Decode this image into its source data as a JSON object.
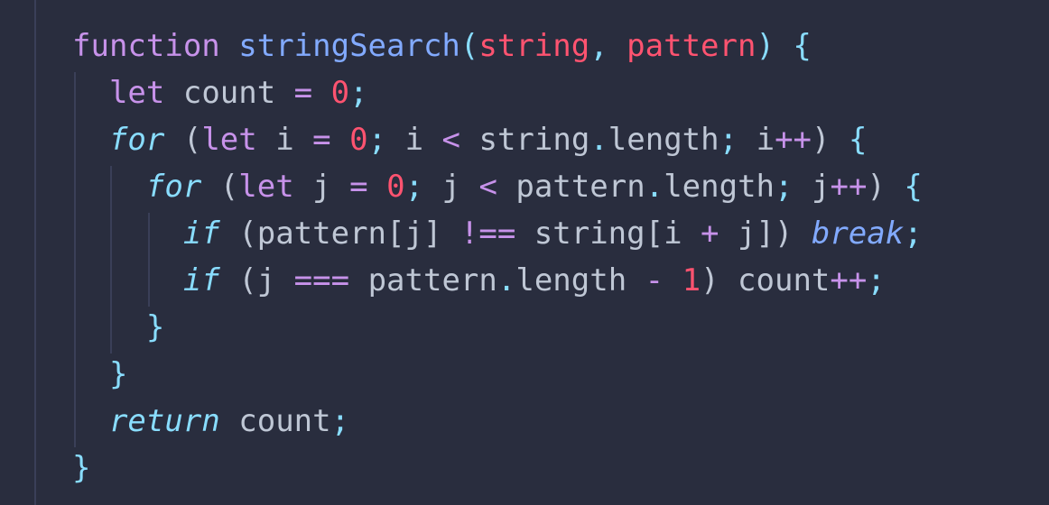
{
  "editor": {
    "theme_colors": {
      "background": "#292d3e",
      "keyword": "#c792ea",
      "function": "#82aaff",
      "parameter": "#ff5370",
      "number": "#ff5370",
      "punctuation": "#89ddff",
      "text": "#bfc7d5"
    },
    "lines": [
      {
        "tokens": [
          {
            "t": "function",
            "c": "kw"
          },
          {
            "t": " ",
            "c": "plain"
          },
          {
            "t": "stringSearch",
            "c": "fn"
          },
          {
            "t": "(",
            "c": "punc"
          },
          {
            "t": "string",
            "c": "param"
          },
          {
            "t": ", ",
            "c": "punc"
          },
          {
            "t": "pattern",
            "c": "param"
          },
          {
            "t": ")",
            "c": "punc"
          },
          {
            "t": " ",
            "c": "plain"
          },
          {
            "t": "{",
            "c": "punc"
          }
        ]
      },
      {
        "tokens": [
          {
            "t": "  ",
            "c": "plain"
          },
          {
            "t": "let",
            "c": "kw"
          },
          {
            "t": " count ",
            "c": "plain"
          },
          {
            "t": "=",
            "c": "op"
          },
          {
            "t": " ",
            "c": "plain"
          },
          {
            "t": "0",
            "c": "num-red"
          },
          {
            "t": ";",
            "c": "punc"
          }
        ]
      },
      {
        "tokens": [
          {
            "t": "  ",
            "c": "plain"
          },
          {
            "t": "for",
            "c": "ctl"
          },
          {
            "t": " (",
            "c": "plain"
          },
          {
            "t": "let",
            "c": "kw"
          },
          {
            "t": " i ",
            "c": "plain"
          },
          {
            "t": "=",
            "c": "op"
          },
          {
            "t": " ",
            "c": "plain"
          },
          {
            "t": "0",
            "c": "num-red"
          },
          {
            "t": ";",
            "c": "punc"
          },
          {
            "t": " i ",
            "c": "plain"
          },
          {
            "t": "<",
            "c": "op"
          },
          {
            "t": " string",
            "c": "plain"
          },
          {
            "t": ".",
            "c": "punc"
          },
          {
            "t": "length",
            "c": "prop"
          },
          {
            "t": ";",
            "c": "punc"
          },
          {
            "t": " i",
            "c": "plain"
          },
          {
            "t": "++",
            "c": "op"
          },
          {
            "t": ") ",
            "c": "plain"
          },
          {
            "t": "{",
            "c": "punc"
          }
        ]
      },
      {
        "tokens": [
          {
            "t": "    ",
            "c": "plain"
          },
          {
            "t": "for",
            "c": "ctl"
          },
          {
            "t": " (",
            "c": "plain"
          },
          {
            "t": "let",
            "c": "kw"
          },
          {
            "t": " j ",
            "c": "plain"
          },
          {
            "t": "=",
            "c": "op"
          },
          {
            "t": " ",
            "c": "plain"
          },
          {
            "t": "0",
            "c": "num-red"
          },
          {
            "t": ";",
            "c": "punc"
          },
          {
            "t": " j ",
            "c": "plain"
          },
          {
            "t": "<",
            "c": "op"
          },
          {
            "t": " pattern",
            "c": "plain"
          },
          {
            "t": ".",
            "c": "punc"
          },
          {
            "t": "length",
            "c": "prop"
          },
          {
            "t": ";",
            "c": "punc"
          },
          {
            "t": " j",
            "c": "plain"
          },
          {
            "t": "++",
            "c": "op"
          },
          {
            "t": ") ",
            "c": "plain"
          },
          {
            "t": "{",
            "c": "punc"
          }
        ]
      },
      {
        "tokens": [
          {
            "t": "      ",
            "c": "plain"
          },
          {
            "t": "if",
            "c": "ctl"
          },
          {
            "t": " (pattern[j] ",
            "c": "plain"
          },
          {
            "t": "!==",
            "c": "op"
          },
          {
            "t": " string[i ",
            "c": "plain"
          },
          {
            "t": "+",
            "c": "op"
          },
          {
            "t": " j]) ",
            "c": "plain"
          },
          {
            "t": "break",
            "c": "brk"
          },
          {
            "t": ";",
            "c": "punc"
          }
        ]
      },
      {
        "tokens": [
          {
            "t": "      ",
            "c": "plain"
          },
          {
            "t": "if",
            "c": "ctl"
          },
          {
            "t": " (j ",
            "c": "plain"
          },
          {
            "t": "===",
            "c": "op"
          },
          {
            "t": " pattern",
            "c": "plain"
          },
          {
            "t": ".",
            "c": "punc"
          },
          {
            "t": "length ",
            "c": "prop"
          },
          {
            "t": "-",
            "c": "op"
          },
          {
            "t": " ",
            "c": "plain"
          },
          {
            "t": "1",
            "c": "num-red"
          },
          {
            "t": ") count",
            "c": "plain"
          },
          {
            "t": "++",
            "c": "op"
          },
          {
            "t": ";",
            "c": "punc"
          }
        ]
      },
      {
        "tokens": [
          {
            "t": "    ",
            "c": "plain"
          },
          {
            "t": "}",
            "c": "punc"
          }
        ]
      },
      {
        "tokens": [
          {
            "t": "  ",
            "c": "plain"
          },
          {
            "t": "}",
            "c": "punc"
          }
        ]
      },
      {
        "tokens": [
          {
            "t": "  ",
            "c": "plain"
          },
          {
            "t": "return",
            "c": "ctl"
          },
          {
            "t": " count",
            "c": "plain"
          },
          {
            "t": ";",
            "c": "punc"
          }
        ]
      },
      {
        "tokens": [
          {
            "t": "}",
            "c": "punc"
          }
        ]
      }
    ]
  }
}
